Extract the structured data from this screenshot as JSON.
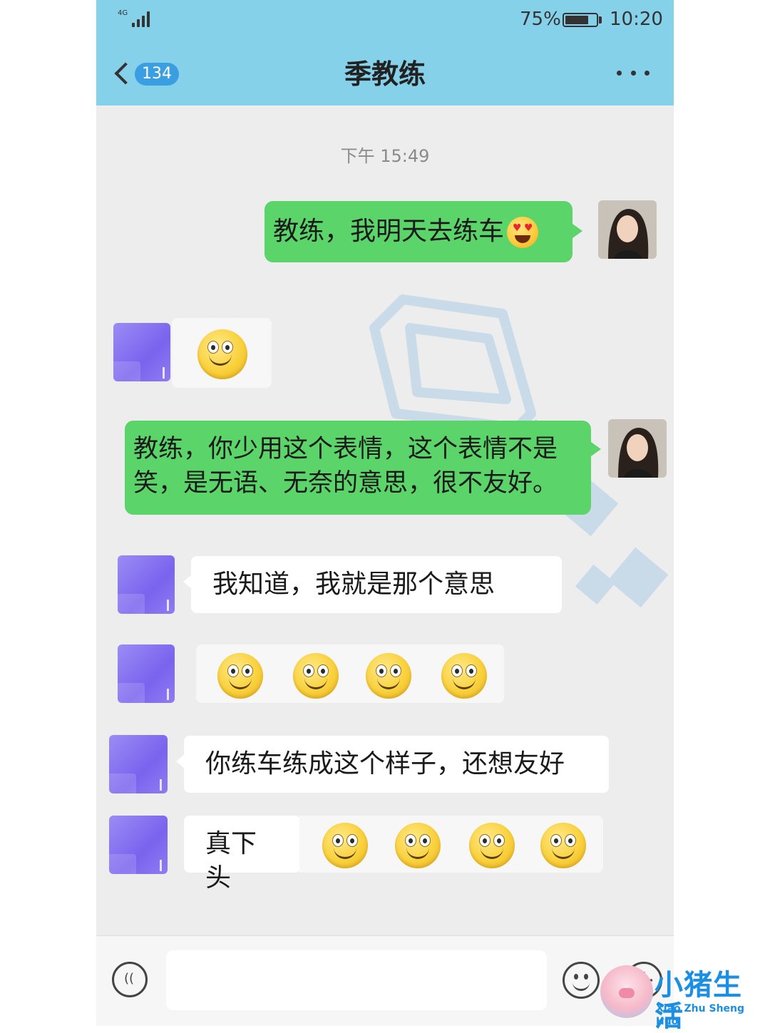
{
  "status_bar": {
    "network": "4G",
    "battery_percent": "75%",
    "battery_level": 0.75,
    "time": "10:20"
  },
  "nav": {
    "back_badge": "134",
    "title": "季教练"
  },
  "chat": {
    "timestamp": "下午 15:49",
    "messages": [
      {
        "sender": "me",
        "text": "教练，我明天去练车",
        "emoji": "heart-eyes"
      },
      {
        "sender": "coach",
        "emoji_count": 1,
        "emoji": "smile"
      },
      {
        "sender": "me",
        "line1": "教练，你少用这个表情，这个表情不是",
        "line2": "笑，是无语、无奈的意思，很不友好。"
      },
      {
        "sender": "coach",
        "text": "我知道，我就是那个意思"
      },
      {
        "sender": "coach",
        "emoji_count": 4,
        "emoji": "smile"
      },
      {
        "sender": "coach",
        "text": "你练车练成这个样子，还想友好"
      },
      {
        "sender": "coach",
        "text": "真下头",
        "emoji_count": 4,
        "emoji": "smile"
      }
    ]
  },
  "input_bar": {
    "value": "",
    "icons": [
      "voice-icon",
      "emoji-icon",
      "plus-icon"
    ]
  },
  "brand": {
    "name": "小猪生活",
    "pinyin": "Xiao Zhu Sheng Huo"
  },
  "colors": {
    "header": "#86d1ea",
    "bubble_self": "#5bd46a",
    "bubble_other": "#ffffff",
    "badge": "#3a9ee0",
    "brand": "#1a8fe3"
  }
}
